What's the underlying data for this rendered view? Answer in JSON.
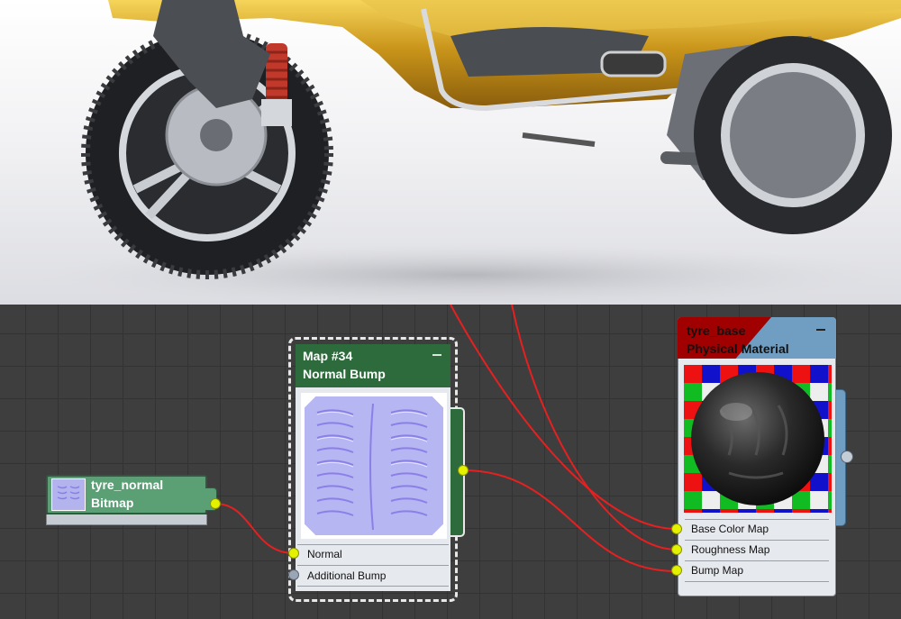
{
  "bitmap_node": {
    "name": "tyre_normal",
    "type": "Bitmap"
  },
  "bump_node": {
    "name": "Map #34",
    "type": "Normal Bump",
    "inputs": [
      {
        "label": "Normal",
        "connected": true
      },
      {
        "label": "Additional Bump",
        "connected": false
      }
    ]
  },
  "material_node": {
    "name": "tyre_base",
    "type": "Physical Material",
    "inputs": [
      {
        "label": "Base Color Map"
      },
      {
        "label": "Roughness Map"
      },
      {
        "label": "Bump Map"
      }
    ]
  },
  "colors": {
    "wire": "#e62020",
    "port_connected": "#e4f200",
    "port_empty": "#9aa6b6",
    "bitmap_header": "#5aa074",
    "bump_header": "#2e6b3c",
    "material_header": "#6f9ec2",
    "material_badge": "#a00000",
    "node_body": "#e6e9ee"
  }
}
